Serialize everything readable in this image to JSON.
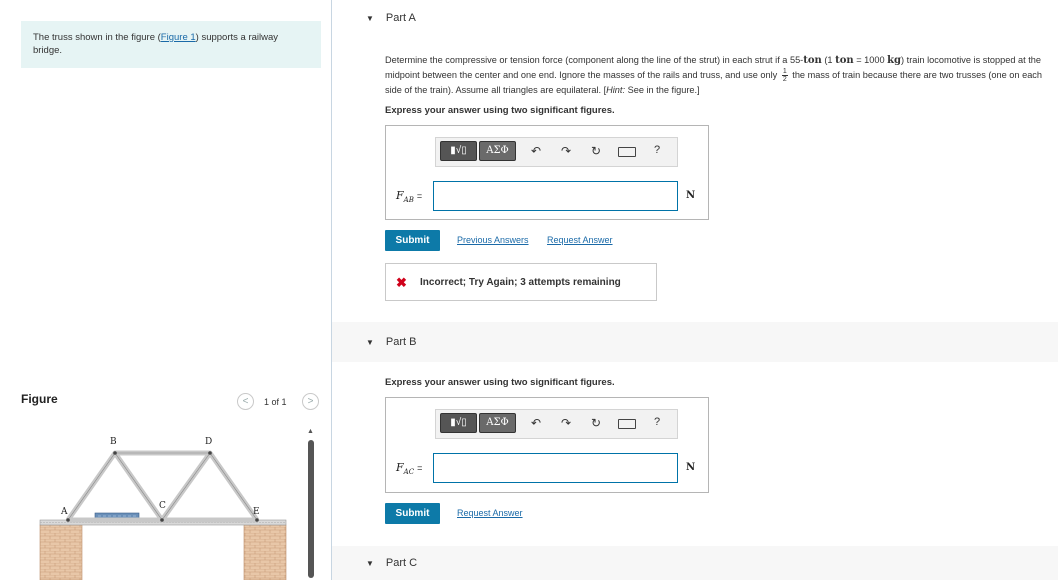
{
  "problem": {
    "text_before": "The truss shown in the figure (",
    "figure_link": "Figure 1",
    "text_after": ") supports a railway bridge."
  },
  "figure": {
    "title": "Figure",
    "counter": "1 of 1",
    "labels": {
      "a": "A",
      "b": "B",
      "c": "C",
      "d": "D",
      "e": "E"
    }
  },
  "part_a": {
    "header": "Part A",
    "question": {
      "t1": "Determine the compressive or tension force (component along the line of the strut) in each strut if a 55-",
      "ton1": "ton",
      "t2": " (1 ",
      "ton2": "ton",
      "t3": " = 1000 ",
      "kg": "kg",
      "t4": ") train locomotive is stopped at the midpoint between the center and one end. Ignore the masses of the rails and truss, and use only ",
      "frac_num": "1",
      "frac_den": "2",
      "t5": " the mass of train because there are two trusses (one on each side of the train). Assume all triangles are equilateral. [",
      "hint_label": "Hint:",
      "t6": " See in the figure.]"
    },
    "instruction": "Express your answer using two significant figures.",
    "variable": {
      "symbol": "F",
      "subscript": "AB",
      "equals": "="
    },
    "input_value": "",
    "unit": "N",
    "submit_label": "Submit",
    "previous_answers_label": "Previous Answers",
    "request_answer_label": "Request Answer",
    "feedback": {
      "icon": "✖",
      "text": "Incorrect; Try Again; 3 attempts remaining"
    }
  },
  "part_b": {
    "header": "Part B",
    "instruction": "Express your answer using two significant figures.",
    "variable": {
      "symbol": "F",
      "subscript": "AC",
      "equals": "="
    },
    "input_value": "",
    "unit": "N",
    "submit_label": "Submit",
    "request_answer_label": "Request Answer"
  },
  "part_c": {
    "header": "Part C"
  },
  "toolbar": {
    "template_label": "▮√▯",
    "greek_label": "ΑΣΦ",
    "undo": "↶",
    "redo": "↷",
    "reset": "↻",
    "help": "?"
  },
  "icons": {
    "caret": "▼",
    "prev": "<",
    "next": ">",
    "scroll_up": "▲"
  },
  "colors": {
    "submit_bg": "#0d7aa8",
    "link": "#1a6aa8",
    "error": "#d0021b",
    "problem_bg": "#e6f4f4"
  }
}
